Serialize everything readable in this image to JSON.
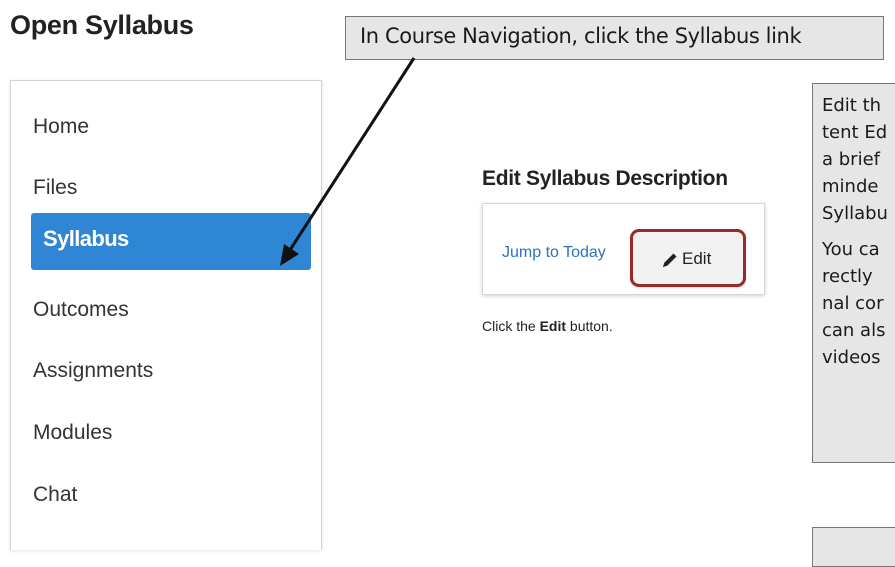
{
  "page_title": "Open Syllabus",
  "callout_top": "In Course Navigation, click the Syllabus link",
  "nav": {
    "items": [
      {
        "label": "Home",
        "active": false
      },
      {
        "label": "Files",
        "active": false
      },
      {
        "label": "Syllabus",
        "active": true
      },
      {
        "label": "Outcomes",
        "active": false
      },
      {
        "label": "Assignments",
        "active": false
      },
      {
        "label": "Modules",
        "active": false
      },
      {
        "label": "Chat",
        "active": false
      }
    ]
  },
  "edit_section": {
    "heading": "Edit Syllabus Description",
    "jump_link": "Jump to Today",
    "edit_button": "Edit",
    "caption_prefix": "Click the ",
    "caption_bold": "Edit",
    "caption_suffix": " button."
  },
  "callout_right": {
    "lines": [
      "Edit th",
      "tent Ed",
      "a brief",
      "minde",
      "Syllabu",
      "You ca",
      "rectly",
      "nal cor",
      "can als",
      "videos"
    ]
  },
  "colors": {
    "nav_active": "#2f86d4",
    "edit_highlight": "#9a2a2a",
    "link": "#2d72b8"
  },
  "icons": {
    "edit": "pencil-icon"
  }
}
